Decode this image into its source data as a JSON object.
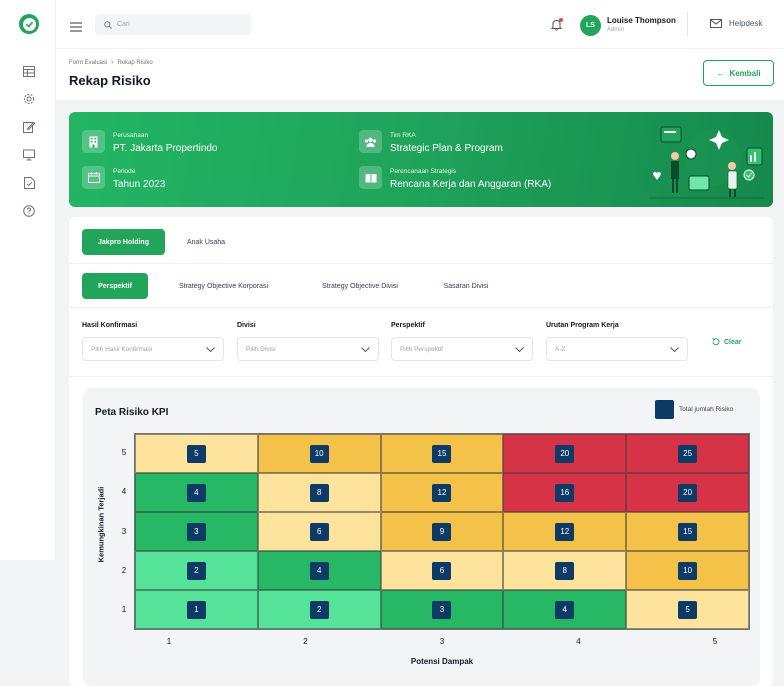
{
  "topbar": {
    "search_placeholder": "Cari",
    "user": {
      "initials": "LS",
      "name": "Louise Thompson",
      "role": "Admin"
    },
    "helpdesk_label": "Helpdesk"
  },
  "breadcrumb": {
    "parent": "Form Evaluasi",
    "current": "Rekap Risiko"
  },
  "page_title": "Rekap Risiko",
  "back_button": "Kembali",
  "banner": {
    "company_label": "Perusahaan",
    "company_value": "PT. Jakarta Propertindo",
    "period_label": "Periode",
    "period_value": "Tahun 2023",
    "team_label": "Tim RKA",
    "team_value": "Strategic Plan & Program",
    "plan_label": "Perencanaan Strategis",
    "plan_value": "Rencana Kerja dan Anggaran (RKA)"
  },
  "tabs_entity": [
    "Jakpro Holding",
    "Anak Usaha"
  ],
  "tabs_view": [
    "Perspektif",
    "Strategy Objective Korporasi",
    "Strategy Objective Divisi",
    "Sasaran Divisi"
  ],
  "filters": [
    {
      "label": "Hasil Konfirmasi",
      "placeholder": "Pilih Hasil Konfirmasi"
    },
    {
      "label": "Divisi",
      "placeholder": "Pilih Divisi"
    },
    {
      "label": "Perspektif",
      "placeholder": "Pilih Perspektif"
    },
    {
      "label": "Urutan Program Kerja",
      "placeholder": "A-Z"
    }
  ],
  "clear_label": "Clear",
  "colors": {
    "accent": "#22a55a",
    "badge": "#0e3a66",
    "level_1": "#55e39a",
    "level_2": "#27b866",
    "level_3": "#fde39c",
    "level_4": "#f4c248",
    "level_5": "#d63346"
  },
  "chart_data": {
    "type": "heatmap",
    "title": "Peta Risiko KPI",
    "legend": "Total jumlah Risiko",
    "xlabel": "Potensi Dampak",
    "ylabel": "Kemungkinan Terjadi",
    "x_ticks": [
      "1",
      "2",
      "3",
      "4",
      "5"
    ],
    "y_ticks": [
      "5",
      "4",
      "3",
      "2",
      "1"
    ],
    "rows": [
      {
        "y": 5,
        "values": [
          5,
          10,
          15,
          20,
          25
        ],
        "levels": [
          3,
          4,
          4,
          5,
          5
        ]
      },
      {
        "y": 4,
        "values": [
          4,
          8,
          12,
          16,
          20
        ],
        "levels": [
          2,
          3,
          4,
          5,
          5
        ]
      },
      {
        "y": 3,
        "values": [
          3,
          6,
          9,
          12,
          15
        ],
        "levels": [
          2,
          3,
          4,
          4,
          4
        ]
      },
      {
        "y": 2,
        "values": [
          2,
          4,
          6,
          8,
          10
        ],
        "levels": [
          1,
          2,
          3,
          3,
          4
        ]
      },
      {
        "y": 1,
        "values": [
          1,
          2,
          3,
          4,
          5
        ],
        "levels": [
          1,
          1,
          2,
          2,
          3
        ]
      }
    ]
  }
}
